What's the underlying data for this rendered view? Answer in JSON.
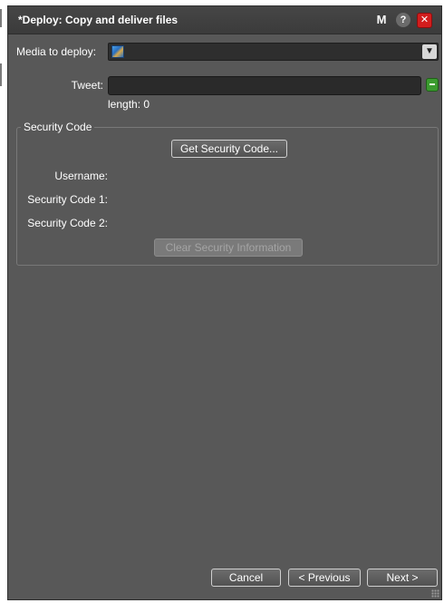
{
  "dialog": {
    "title": "*Deploy: Copy and deliver files",
    "title_buttons": {
      "m_label": "M",
      "help_label": "?",
      "close_label": "✕"
    }
  },
  "form": {
    "media_label": "Media to deploy:",
    "media_value_icon": "media-image-icon",
    "media_dropdown_icon": "chevron-down-icon",
    "tweet_label": "Tweet:",
    "tweet_value": "",
    "length_text": "length: 0",
    "add_icon": "green-minus-icon"
  },
  "security": {
    "legend": "Security Code",
    "get_button": "Get Security Code...",
    "username_label": "Username:",
    "code1_label": "Security Code 1:",
    "code2_label": "Security Code 2:",
    "clear_button": "Clear Security Information"
  },
  "footer": {
    "cancel": "Cancel",
    "previous": "< Previous",
    "next": "Next >"
  },
  "colors": {
    "dialog_bg": "#585858",
    "titlebar_bg": "#3f3f3f",
    "close_red": "#d21d1d",
    "accent_green": "#3b9b2f"
  }
}
